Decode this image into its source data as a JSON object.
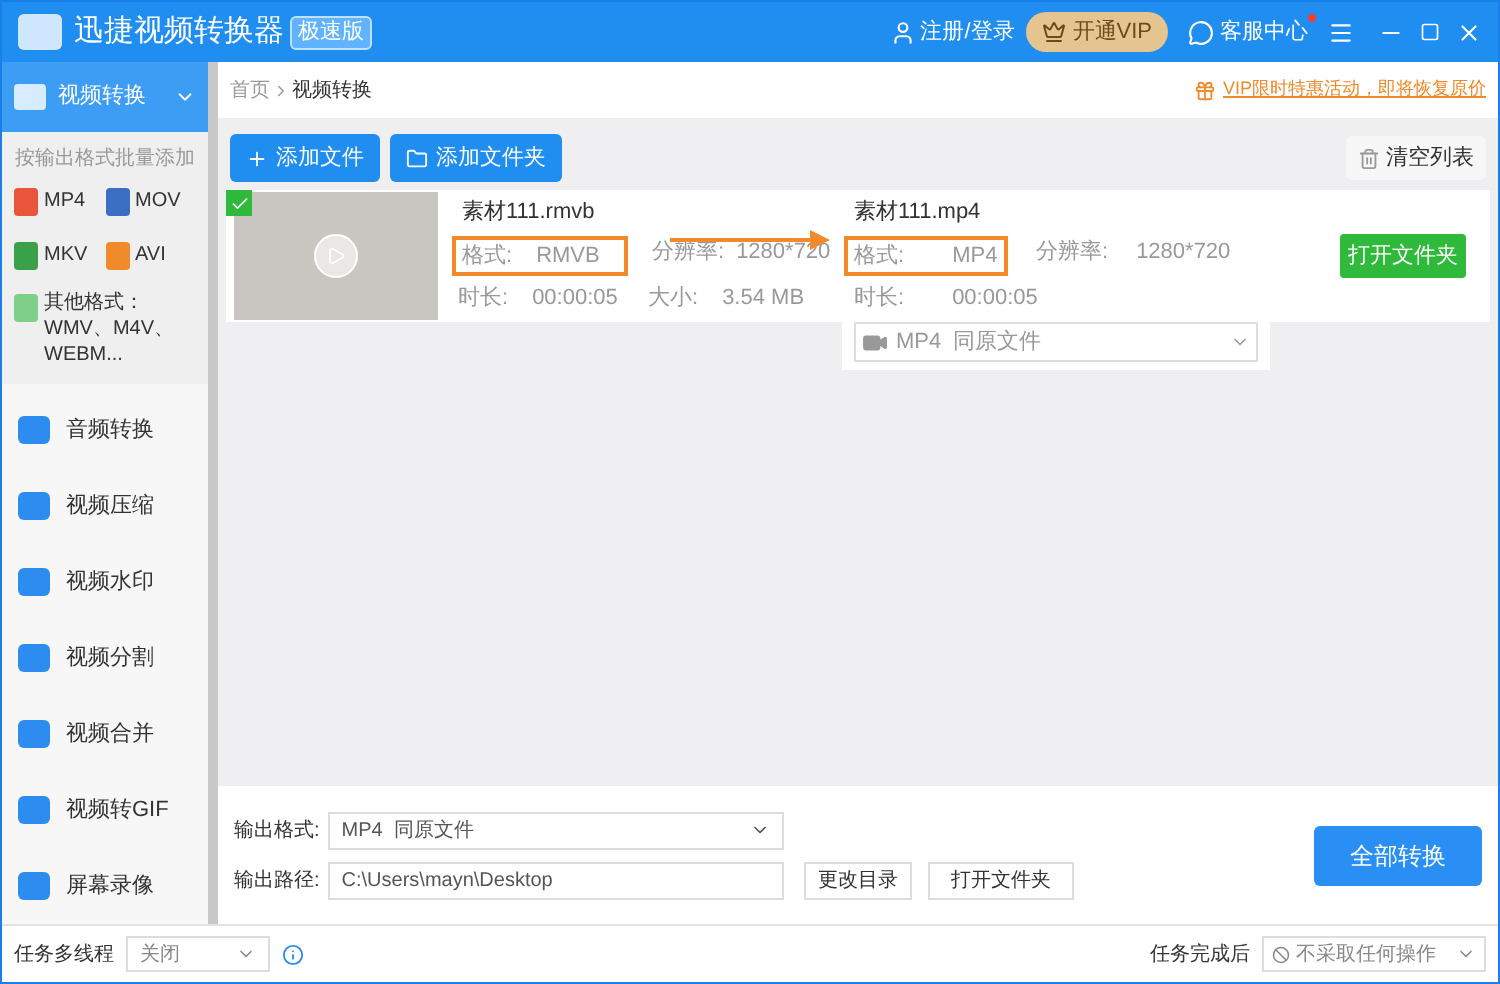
{
  "window": {
    "title": "迅捷视频转换器",
    "badge": "极速版",
    "actions": [
      "注册/登录",
      "开通VIP",
      "客服中心"
    ],
    "has_notification": true
  },
  "sidebar": {
    "items": [
      {
        "label": "视频转换",
        "selected": true,
        "expanded": true
      },
      {
        "label": "音频转换",
        "selected": false
      },
      {
        "label": "视频压缩",
        "selected": false
      },
      {
        "label": "视频水印",
        "selected": false
      },
      {
        "label": "视频分割",
        "selected": false
      },
      {
        "label": "视频合并",
        "selected": false
      },
      {
        "label": "视频转GIF",
        "selected": false
      },
      {
        "label": "屏幕录像",
        "selected": false
      }
    ],
    "batch_title": "按输出格式批量添加",
    "formats": [
      {
        "label": "MP4",
        "color": "#e8553b"
      },
      {
        "label": "MOV",
        "color": "#3a6fc4"
      },
      {
        "label": "MKV",
        "color": "#3aa04a"
      },
      {
        "label": "AVI",
        "color": "#f08a2a"
      }
    ],
    "other_formats": "其他格式：WMV、M4V、WEBM..."
  },
  "breadcrumb": [
    "首页",
    "视频转换"
  ],
  "promo": "VIP限时特惠活动，即将恢复原价",
  "toolbar": {
    "buttons": [
      "添加文件",
      "添加文件夹"
    ],
    "clear": "清空列表"
  },
  "file": {
    "checked": true,
    "source": {
      "name": "素材111.rmvb",
      "format_label": "格式:",
      "format": "RMVB",
      "resolution_label": "分辨率:",
      "resolution": "1280*720",
      "duration_label": "时长:",
      "duration": "00:00:05",
      "size_label": "大小:",
      "size": "3.54 MB"
    },
    "target": {
      "name": "素材111.mp4",
      "format_label": "格式:",
      "format": "MP4",
      "resolution_label": "分辨率:",
      "resolution": "1280*720",
      "duration_label": "时长:",
      "duration": "00:00:05",
      "select": "MP4  同原文件"
    },
    "open_button": "打开文件夹"
  },
  "output": {
    "format_label": "输出格式:",
    "format": "MP4  同原文件",
    "path_label": "输出路径:",
    "path": "C:\\Users\\mayn\\Desktop",
    "change_button": "更改目录",
    "open_button": "打开文件夹",
    "convert_button": "全部转换"
  },
  "status_bar": {
    "thread_label": "任务多线程",
    "thread_value": "关闭",
    "after_label": "任务完成后",
    "after_value": "不采取任何操作"
  }
}
